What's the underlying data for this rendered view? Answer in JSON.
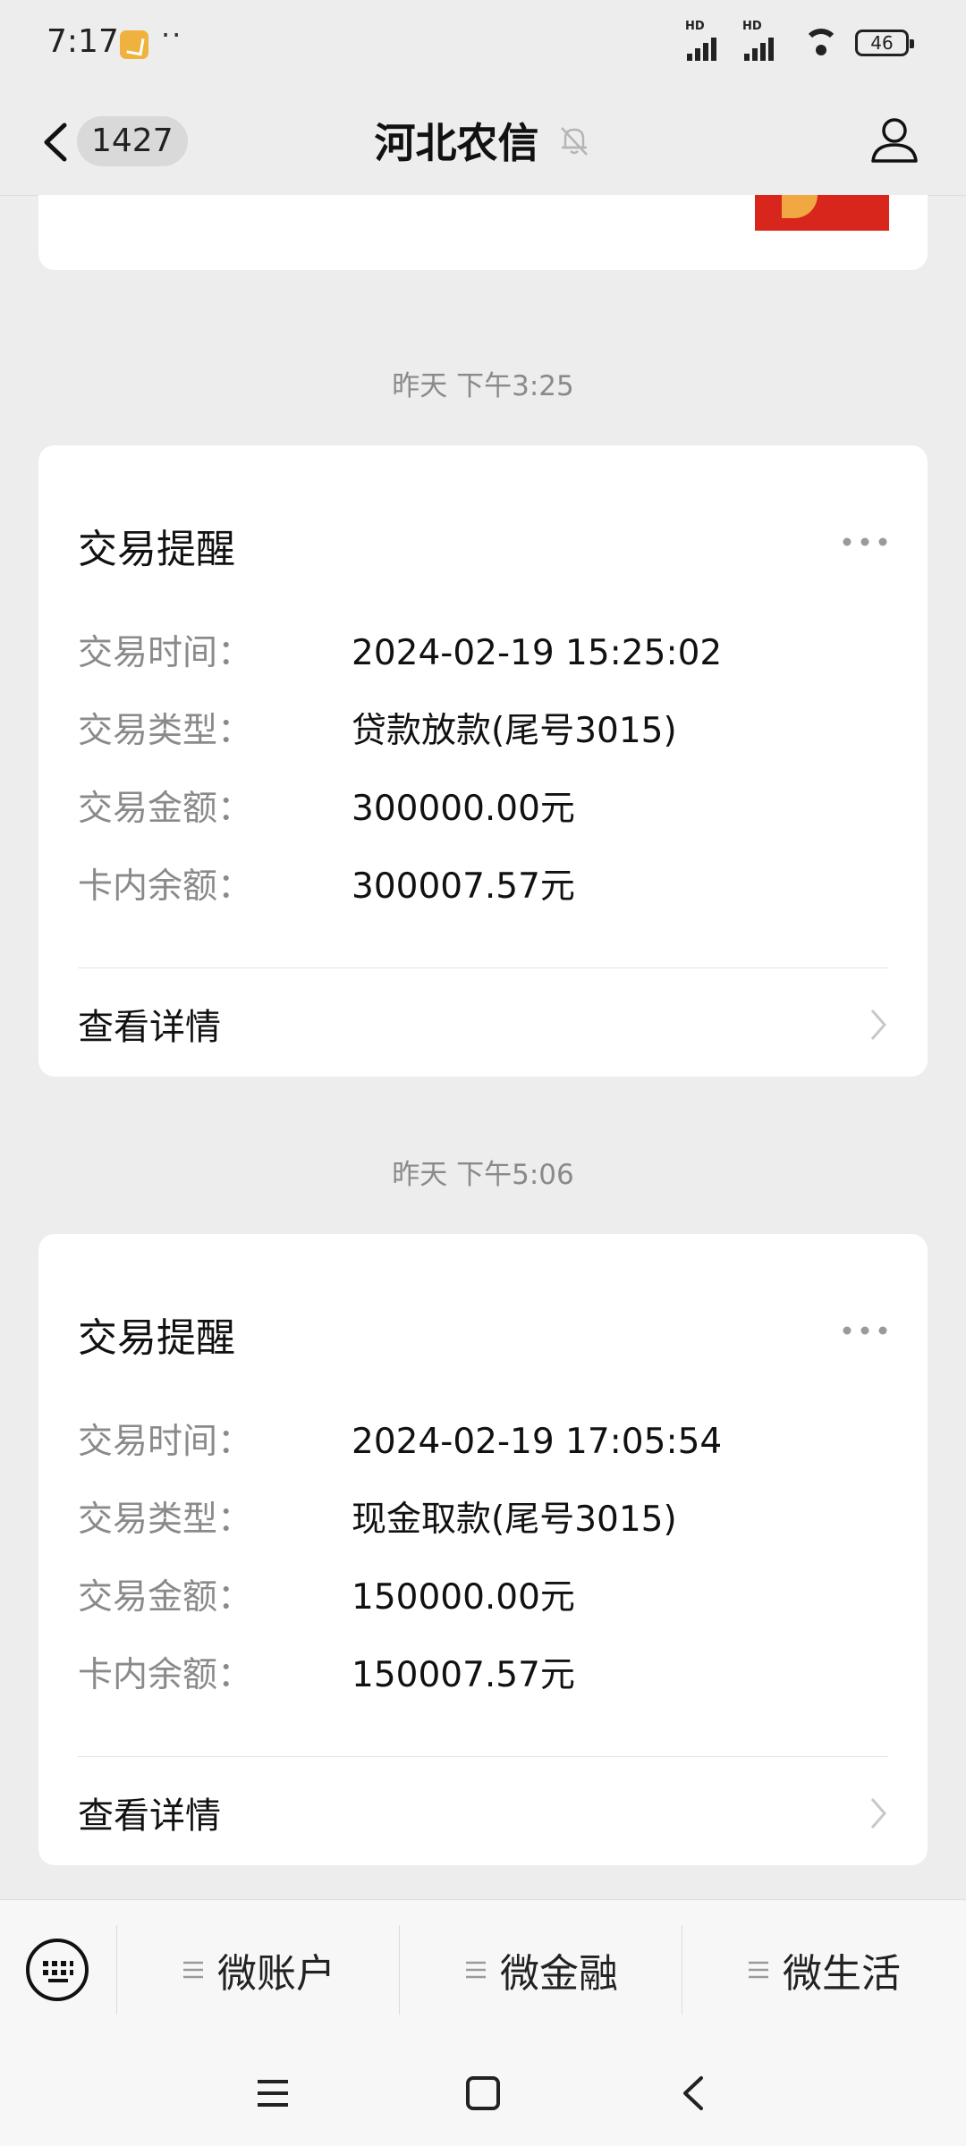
{
  "status_bar": {
    "time": "7:17",
    "dots": "··",
    "signal_label_1": "HD",
    "signal_label_2": "HD",
    "battery": "46"
  },
  "header": {
    "unread_count": "1427",
    "title": "河北农信"
  },
  "messages": [
    {
      "timestamp": "昨天 下午3:25",
      "card_title": "交易提醒",
      "fields": [
        {
          "label": "交易时间：",
          "value": "2024-02-19  15:25:02"
        },
        {
          "label": "交易类型：",
          "value": "贷款放款(尾号3015)"
        },
        {
          "label": "交易金额：",
          "value": "300000.00元"
        },
        {
          "label": "卡内余额：",
          "value": "300007.57元"
        }
      ],
      "detail_link": "查看详情"
    },
    {
      "timestamp": "昨天 下午5:06",
      "card_title": "交易提醒",
      "fields": [
        {
          "label": "交易时间：",
          "value": "2024-02-19  17:05:54"
        },
        {
          "label": "交易类型：",
          "value": "现金取款(尾号3015)"
        },
        {
          "label": "交易金额：",
          "value": "150000.00元"
        },
        {
          "label": "卡内余额：",
          "value": "150007.57元"
        }
      ],
      "detail_link": "查看详情"
    }
  ],
  "menu": {
    "items": [
      {
        "label": "微账户"
      },
      {
        "label": "微金融"
      },
      {
        "label": "微生活"
      }
    ]
  },
  "icons": {
    "back": "chevron-left-icon",
    "mute": "bell-off-icon",
    "profile": "person-icon",
    "more": "more-dots-icon",
    "keyboard": "keyboard-icon",
    "nav_menu": "menu-icon",
    "nav_home": "home-square-icon",
    "nav_back": "back-icon"
  }
}
